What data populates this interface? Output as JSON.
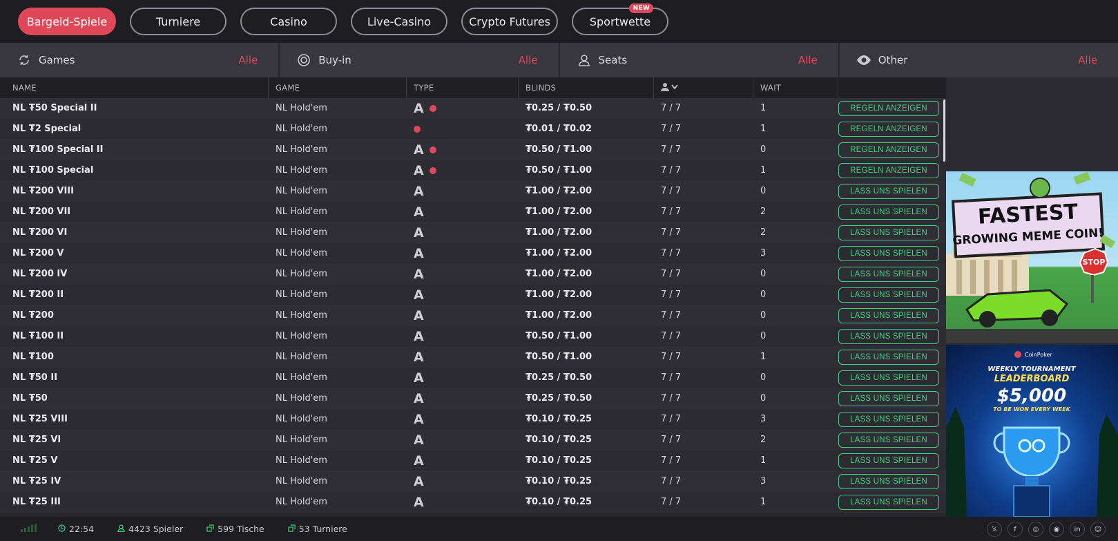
{
  "nav": {
    "tabs": [
      {
        "label": "Bargeld-Spiele",
        "active": true
      },
      {
        "label": "Turniere"
      },
      {
        "label": "Casino"
      },
      {
        "label": "Live-Casino"
      },
      {
        "label": "Crypto Futures"
      },
      {
        "label": "Sportwette",
        "badge": "NEW"
      }
    ]
  },
  "filters": [
    {
      "label": "Games",
      "value": "Alle",
      "icon": "refresh-icon"
    },
    {
      "label": "Buy-in",
      "value": "Alle",
      "icon": "chip-icon"
    },
    {
      "label": "Seats",
      "value": "Alle",
      "icon": "user-icon"
    },
    {
      "label": "Other",
      "value": "Alle",
      "icon": "eye-icon"
    }
  ],
  "table": {
    "headers": {
      "name": "NAME",
      "game": "GAME",
      "type": "TYPE",
      "blinds": "BLINDS",
      "seats_icon": "user-sort-icon",
      "wait": "WAIT"
    },
    "rows": [
      {
        "name": "NL ₮50 Special II",
        "game": "NL  Hold'em",
        "anon": true,
        "dot": true,
        "blinds": "₮0.25 / ₮0.50",
        "seats": "7 / 7",
        "wait": "1",
        "action": "REGELN ANZEIGEN"
      },
      {
        "name": "NL ₮2 Special",
        "game": "NL  Hold'em",
        "anon": false,
        "dot": true,
        "blinds": "₮0.01 / ₮0.02",
        "seats": "7 / 7",
        "wait": "1",
        "action": "REGELN ANZEIGEN"
      },
      {
        "name": "NL ₮100 Special II",
        "game": "NL  Hold'em",
        "anon": true,
        "dot": true,
        "blinds": "₮0.50 / ₮1.00",
        "seats": "7 / 7",
        "wait": "0",
        "action": "REGELN ANZEIGEN"
      },
      {
        "name": "NL ₮100 Special",
        "game": "NL  Hold'em",
        "anon": true,
        "dot": true,
        "blinds": "₮0.50 / ₮1.00",
        "seats": "7 / 7",
        "wait": "1",
        "action": "REGELN ANZEIGEN"
      },
      {
        "name": "NL ₮200 VIII",
        "game": "NL  Hold'em",
        "anon": true,
        "dot": false,
        "blinds": "₮1.00 / ₮2.00",
        "seats": "7 / 7",
        "wait": "0",
        "action": "LASS UNS SPIELEN"
      },
      {
        "name": "NL ₮200 VII",
        "game": "NL  Hold'em",
        "anon": true,
        "dot": false,
        "blinds": "₮1.00 / ₮2.00",
        "seats": "7 / 7",
        "wait": "2",
        "action": "LASS UNS SPIELEN"
      },
      {
        "name": "NL ₮200 VI",
        "game": "NL  Hold'em",
        "anon": true,
        "dot": false,
        "blinds": "₮1.00 / ₮2.00",
        "seats": "7 / 7",
        "wait": "2",
        "action": "LASS UNS SPIELEN"
      },
      {
        "name": "NL ₮200 V",
        "game": "NL  Hold'em",
        "anon": true,
        "dot": false,
        "blinds": "₮1.00 / ₮2.00",
        "seats": "7 / 7",
        "wait": "3",
        "action": "LASS UNS SPIELEN"
      },
      {
        "name": "NL ₮200 IV",
        "game": "NL  Hold'em",
        "anon": true,
        "dot": false,
        "blinds": "₮1.00 / ₮2.00",
        "seats": "7 / 7",
        "wait": "0",
        "action": "LASS UNS SPIELEN"
      },
      {
        "name": "NL ₮200 II",
        "game": "NL  Hold'em",
        "anon": true,
        "dot": false,
        "blinds": "₮1.00 / ₮2.00",
        "seats": "7 / 7",
        "wait": "0",
        "action": "LASS UNS SPIELEN"
      },
      {
        "name": "NL ₮200",
        "game": "NL  Hold'em",
        "anon": true,
        "dot": false,
        "blinds": "₮1.00 / ₮2.00",
        "seats": "7 / 7",
        "wait": "0",
        "action": "LASS UNS SPIELEN"
      },
      {
        "name": "NL ₮100 II",
        "game": "NL  Hold'em",
        "anon": true,
        "dot": false,
        "blinds": "₮0.50 / ₮1.00",
        "seats": "7 / 7",
        "wait": "0",
        "action": "LASS UNS SPIELEN"
      },
      {
        "name": "NL ₮100",
        "game": "NL  Hold'em",
        "anon": true,
        "dot": false,
        "blinds": "₮0.50 / ₮1.00",
        "seats": "7 / 7",
        "wait": "1",
        "action": "LASS UNS SPIELEN"
      },
      {
        "name": "NL ₮50 II",
        "game": "NL  Hold'em",
        "anon": true,
        "dot": false,
        "blinds": "₮0.25 / ₮0.50",
        "seats": "7 / 7",
        "wait": "0",
        "action": "LASS UNS SPIELEN"
      },
      {
        "name": "NL ₮50",
        "game": "NL  Hold'em",
        "anon": true,
        "dot": false,
        "blinds": "₮0.25 / ₮0.50",
        "seats": "7 / 7",
        "wait": "0",
        "action": "LASS UNS SPIELEN"
      },
      {
        "name": "NL ₮25 VIII",
        "game": "NL  Hold'em",
        "anon": true,
        "dot": false,
        "blinds": "₮0.10 / ₮0.25",
        "seats": "7 / 7",
        "wait": "3",
        "action": "LASS UNS SPIELEN"
      },
      {
        "name": "NL ₮25 VI",
        "game": "NL  Hold'em",
        "anon": true,
        "dot": false,
        "blinds": "₮0.10 / ₮0.25",
        "seats": "7 / 7",
        "wait": "2",
        "action": "LASS UNS SPIELEN"
      },
      {
        "name": "NL ₮25 V",
        "game": "NL  Hold'em",
        "anon": true,
        "dot": false,
        "blinds": "₮0.10 / ₮0.25",
        "seats": "7 / 7",
        "wait": "1",
        "action": "LASS UNS SPIELEN"
      },
      {
        "name": "NL ₮25 IV",
        "game": "NL  Hold'em",
        "anon": true,
        "dot": false,
        "blinds": "₮0.10 / ₮0.25",
        "seats": "7 / 7",
        "wait": "3",
        "action": "LASS UNS SPIELEN"
      },
      {
        "name": "NL ₮25 III",
        "game": "NL  Hold'em",
        "anon": true,
        "dot": false,
        "blinds": "₮0.10 / ₮0.25",
        "seats": "7 / 7",
        "wait": "1",
        "action": "LASS UNS SPIELEN"
      }
    ],
    "anon_glyph": "A"
  },
  "ads": {
    "ad1": {
      "line1": "FASTEST",
      "line2": "GROWING MEME COIN!",
      "sign": "STOP"
    },
    "ad2": {
      "brand": "CoinPoker",
      "line1": "WEEKLY TOURNAMENT",
      "line2": "LEADERBOARD",
      "amount": "$5,000",
      "line3": "TO BE WON EVERY WEEK"
    }
  },
  "footer": {
    "time": "22:54",
    "players": "4423 Spieler",
    "tables": "599 Tische",
    "tournaments": "53 Turniere",
    "social": [
      {
        "icon": "x-icon",
        "glyph": "𝕏"
      },
      {
        "icon": "facebook-icon",
        "glyph": "f"
      },
      {
        "icon": "instagram-icon",
        "glyph": "◎"
      },
      {
        "icon": "discord-icon",
        "glyph": "◉"
      },
      {
        "icon": "linkedin-icon",
        "glyph": "in"
      },
      {
        "icon": "reddit-icon",
        "glyph": "☺"
      }
    ]
  },
  "colors": {
    "accent": "#e0485a",
    "green": "#3fd17f"
  }
}
